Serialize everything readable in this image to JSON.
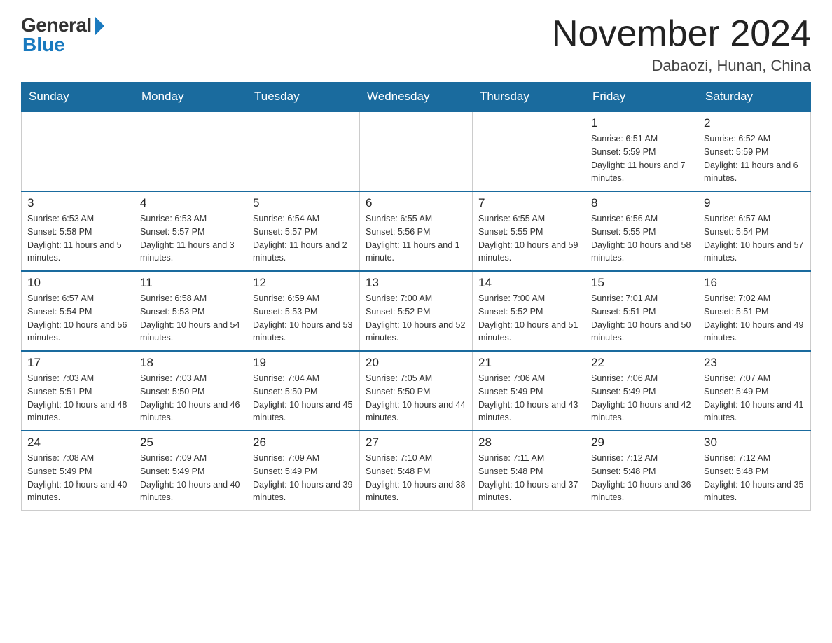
{
  "logo": {
    "general": "General",
    "blue": "Blue"
  },
  "title": "November 2024",
  "subtitle": "Dabaozi, Hunan, China",
  "weekdays": [
    "Sunday",
    "Monday",
    "Tuesday",
    "Wednesday",
    "Thursday",
    "Friday",
    "Saturday"
  ],
  "weeks": [
    [
      {
        "day": "",
        "info": ""
      },
      {
        "day": "",
        "info": ""
      },
      {
        "day": "",
        "info": ""
      },
      {
        "day": "",
        "info": ""
      },
      {
        "day": "",
        "info": ""
      },
      {
        "day": "1",
        "info": "Sunrise: 6:51 AM\nSunset: 5:59 PM\nDaylight: 11 hours and 7 minutes."
      },
      {
        "day": "2",
        "info": "Sunrise: 6:52 AM\nSunset: 5:59 PM\nDaylight: 11 hours and 6 minutes."
      }
    ],
    [
      {
        "day": "3",
        "info": "Sunrise: 6:53 AM\nSunset: 5:58 PM\nDaylight: 11 hours and 5 minutes."
      },
      {
        "day": "4",
        "info": "Sunrise: 6:53 AM\nSunset: 5:57 PM\nDaylight: 11 hours and 3 minutes."
      },
      {
        "day": "5",
        "info": "Sunrise: 6:54 AM\nSunset: 5:57 PM\nDaylight: 11 hours and 2 minutes."
      },
      {
        "day": "6",
        "info": "Sunrise: 6:55 AM\nSunset: 5:56 PM\nDaylight: 11 hours and 1 minute."
      },
      {
        "day": "7",
        "info": "Sunrise: 6:55 AM\nSunset: 5:55 PM\nDaylight: 10 hours and 59 minutes."
      },
      {
        "day": "8",
        "info": "Sunrise: 6:56 AM\nSunset: 5:55 PM\nDaylight: 10 hours and 58 minutes."
      },
      {
        "day": "9",
        "info": "Sunrise: 6:57 AM\nSunset: 5:54 PM\nDaylight: 10 hours and 57 minutes."
      }
    ],
    [
      {
        "day": "10",
        "info": "Sunrise: 6:57 AM\nSunset: 5:54 PM\nDaylight: 10 hours and 56 minutes."
      },
      {
        "day": "11",
        "info": "Sunrise: 6:58 AM\nSunset: 5:53 PM\nDaylight: 10 hours and 54 minutes."
      },
      {
        "day": "12",
        "info": "Sunrise: 6:59 AM\nSunset: 5:53 PM\nDaylight: 10 hours and 53 minutes."
      },
      {
        "day": "13",
        "info": "Sunrise: 7:00 AM\nSunset: 5:52 PM\nDaylight: 10 hours and 52 minutes."
      },
      {
        "day": "14",
        "info": "Sunrise: 7:00 AM\nSunset: 5:52 PM\nDaylight: 10 hours and 51 minutes."
      },
      {
        "day": "15",
        "info": "Sunrise: 7:01 AM\nSunset: 5:51 PM\nDaylight: 10 hours and 50 minutes."
      },
      {
        "day": "16",
        "info": "Sunrise: 7:02 AM\nSunset: 5:51 PM\nDaylight: 10 hours and 49 minutes."
      }
    ],
    [
      {
        "day": "17",
        "info": "Sunrise: 7:03 AM\nSunset: 5:51 PM\nDaylight: 10 hours and 48 minutes."
      },
      {
        "day": "18",
        "info": "Sunrise: 7:03 AM\nSunset: 5:50 PM\nDaylight: 10 hours and 46 minutes."
      },
      {
        "day": "19",
        "info": "Sunrise: 7:04 AM\nSunset: 5:50 PM\nDaylight: 10 hours and 45 minutes."
      },
      {
        "day": "20",
        "info": "Sunrise: 7:05 AM\nSunset: 5:50 PM\nDaylight: 10 hours and 44 minutes."
      },
      {
        "day": "21",
        "info": "Sunrise: 7:06 AM\nSunset: 5:49 PM\nDaylight: 10 hours and 43 minutes."
      },
      {
        "day": "22",
        "info": "Sunrise: 7:06 AM\nSunset: 5:49 PM\nDaylight: 10 hours and 42 minutes."
      },
      {
        "day": "23",
        "info": "Sunrise: 7:07 AM\nSunset: 5:49 PM\nDaylight: 10 hours and 41 minutes."
      }
    ],
    [
      {
        "day": "24",
        "info": "Sunrise: 7:08 AM\nSunset: 5:49 PM\nDaylight: 10 hours and 40 minutes."
      },
      {
        "day": "25",
        "info": "Sunrise: 7:09 AM\nSunset: 5:49 PM\nDaylight: 10 hours and 40 minutes."
      },
      {
        "day": "26",
        "info": "Sunrise: 7:09 AM\nSunset: 5:49 PM\nDaylight: 10 hours and 39 minutes."
      },
      {
        "day": "27",
        "info": "Sunrise: 7:10 AM\nSunset: 5:48 PM\nDaylight: 10 hours and 38 minutes."
      },
      {
        "day": "28",
        "info": "Sunrise: 7:11 AM\nSunset: 5:48 PM\nDaylight: 10 hours and 37 minutes."
      },
      {
        "day": "29",
        "info": "Sunrise: 7:12 AM\nSunset: 5:48 PM\nDaylight: 10 hours and 36 minutes."
      },
      {
        "day": "30",
        "info": "Sunrise: 7:12 AM\nSunset: 5:48 PM\nDaylight: 10 hours and 35 minutes."
      }
    ]
  ]
}
